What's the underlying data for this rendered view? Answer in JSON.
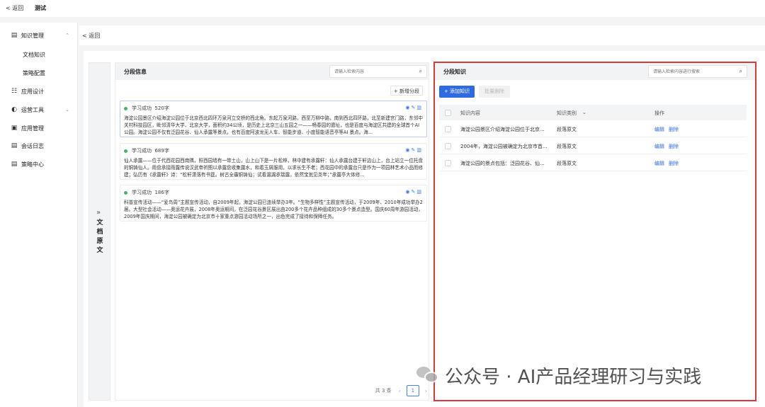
{
  "topbar": {
    "back": "< 返回",
    "title": "测试"
  },
  "sidebar": {
    "items": [
      {
        "icon": "database-icon",
        "label": "知识管理",
        "chevron": "⌃"
      },
      {
        "sub": "文档知识"
      },
      {
        "sub": "策略配置"
      },
      {
        "icon": "settings-icon",
        "label": "应用设计"
      },
      {
        "icon": "tools-icon",
        "label": "运营工具",
        "chevron": "⌄"
      },
      {
        "icon": "app-icon",
        "label": "应用管理"
      },
      {
        "icon": "log-icon",
        "label": "会话日志"
      },
      {
        "icon": "strategy-icon",
        "label": "策略中心"
      }
    ]
  },
  "subheader": {
    "back": "< 返回"
  },
  "doc_strip": {
    "arrows": "»",
    "label": [
      "文",
      "档",
      "原",
      "文"
    ]
  },
  "segments_panel": {
    "title": "分段信息",
    "search_placeholder": "请输入检索内容",
    "add_label": "+ 新增分段",
    "cards": [
      {
        "status": "学习成功",
        "chars": "520字",
        "text": "海淀公园景区介绍海淀公园位于北京西北四环万泉河立交桥的西北角。东起万泉河路，西至万柳中路，南到西北四环路，北至新建宫门路，东邻中关村科技园区，毗邻清华大学、北京大学，面积约34公顷，是历史上北京三山五园之一——畅春园的遗址，也是百度与海淀区共建的全球首个AI 公园。海淀公园不仅有泛园花谷、仙人承露等景点，也有百度阿波龙无人车、智能步道、小度智能语音亭等AI 景点。海..."
      },
      {
        "status": "学习成功",
        "chars": "689字",
        "text": "仙人承露——位于代西花园西南隅，照西园墙有一带土山，山上山下是一片松林，林中建有承露轩：仙人承露台建于轩边山上，台上站立一位托盘的铜铸仙人。用盘承接雨露传说汉武帝祈图以承露盘收集露水，和着玉屑服用，以求长生不老；西花园中的承露台只是作为一项园林艺术小品而修建；弘历有《承露轩》诗：“松轩潇落有书筵。树古全霾铜铸仙；试看漏漏承瑞露，依然宝瓮见尧年；”承露亭大体修..."
      },
      {
        "status": "学习成功",
        "chars": "186字",
        "text": "科普宣传活动——“爱鸟周”主题宣传活动，自2009年起，海淀公园已连续举办3年。“生物多样性”主题宣传活动，于2009年、2010年成功举办2届。大型社会活动——奥运花卉展，2008年奥运期间，在泛园花谷景区展出由200多个花卉品种组成的30多个景点造型。国庆60周年游园活动，2009年国庆期间，海淀公园被确定为北京市十家重点游园活动场所之一，出色完成了接待和保障任务。"
      }
    ],
    "pager": {
      "total": "共 3 条",
      "page": "1"
    }
  },
  "knowledge_panel": {
    "title": "分段知识",
    "search_placeholder": "请输入检索内容进行搜索",
    "add_button": "+ 添加知识",
    "batch_delete": "批量删除",
    "columns": [
      "知识内容",
      "知识类别",
      "操作"
    ],
    "rows": [
      {
        "content": "海淀公园景区介绍海淀公园位于北京...",
        "category": "段落原文",
        "edit": "编辑",
        "delete": "删除"
      },
      {
        "content": "2004年，海淀公园被确定为北京市首...",
        "category": "段落原文",
        "edit": "编辑",
        "delete": "删除"
      },
      {
        "content": "海淀公园的景点包括：泛园花谷、仙...",
        "category": "段落原文",
        "edit": "编辑",
        "delete": "删除"
      }
    ]
  },
  "watermark": "公众号 · AI产品经理研习与实践",
  "colors": {
    "primary": "#2f6be0",
    "highlight_border": "#d93a3a",
    "success": "#42b56b"
  }
}
